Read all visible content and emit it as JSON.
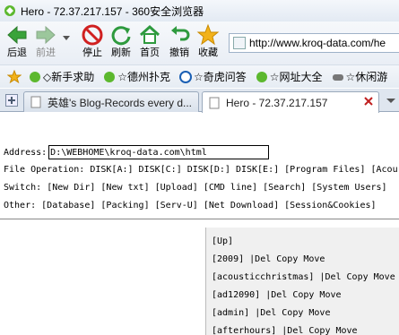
{
  "window": {
    "title": "Hero - 72.37.217.157 - 360安全浏览器"
  },
  "toolbar": {
    "back": "后退",
    "forward": "前进",
    "stop": "停止",
    "refresh": "刷新",
    "home": "首页",
    "undo": "撤销",
    "favorites": "收藏",
    "address_value": "http://www.kroq-data.com/he"
  },
  "favbar": {
    "items": [
      "◇新手求助",
      "☆德州扑克",
      "☆奇虎问答",
      "☆网址大全",
      "☆休闲游"
    ]
  },
  "tabs": [
    {
      "label": "英雄's Blog-Records every d..."
    },
    {
      "label": "Hero - 72.37.217.157"
    }
  ],
  "page": {
    "address_label": "Address:",
    "address_value": "D:\\WEBHOME\\kroq-data.com\\html",
    "file_op_label": "File Operation:",
    "file_op_items": [
      "DISK[A:]",
      "DISK[C:]",
      "DISK[D:]",
      "DISK[E:]",
      "[Program Files]",
      "[Acou"
    ],
    "switch_label": "Switch:",
    "switch_items": [
      "[New Dir]",
      "[New txt]",
      "[Upload]",
      "[CMD line]",
      "[Search]",
      "[System Users]"
    ],
    "other_label": "Other:",
    "other_items": [
      "[Database]",
      "[Packing]",
      "[Serv-U]",
      "[Net Download]",
      "[Session&Cookies]"
    ],
    "dir_up": "[Up]",
    "dirs": [
      {
        "name": "[2009]",
        "actions": "|Del Copy Move"
      },
      {
        "name": "[acousticchristmas]",
        "actions": "|Del Copy Move"
      },
      {
        "name": "[ad12090]",
        "actions": "|Del Copy Move"
      },
      {
        "name": "[admin]",
        "actions": "|Del Copy Move"
      },
      {
        "name": "[afterhours]",
        "actions": "|Del Copy Move"
      }
    ]
  },
  "colors": {
    "green_icon": "#3aa33a",
    "red_icon": "#d02020",
    "blue_link_bg": "#f0f0f0"
  }
}
